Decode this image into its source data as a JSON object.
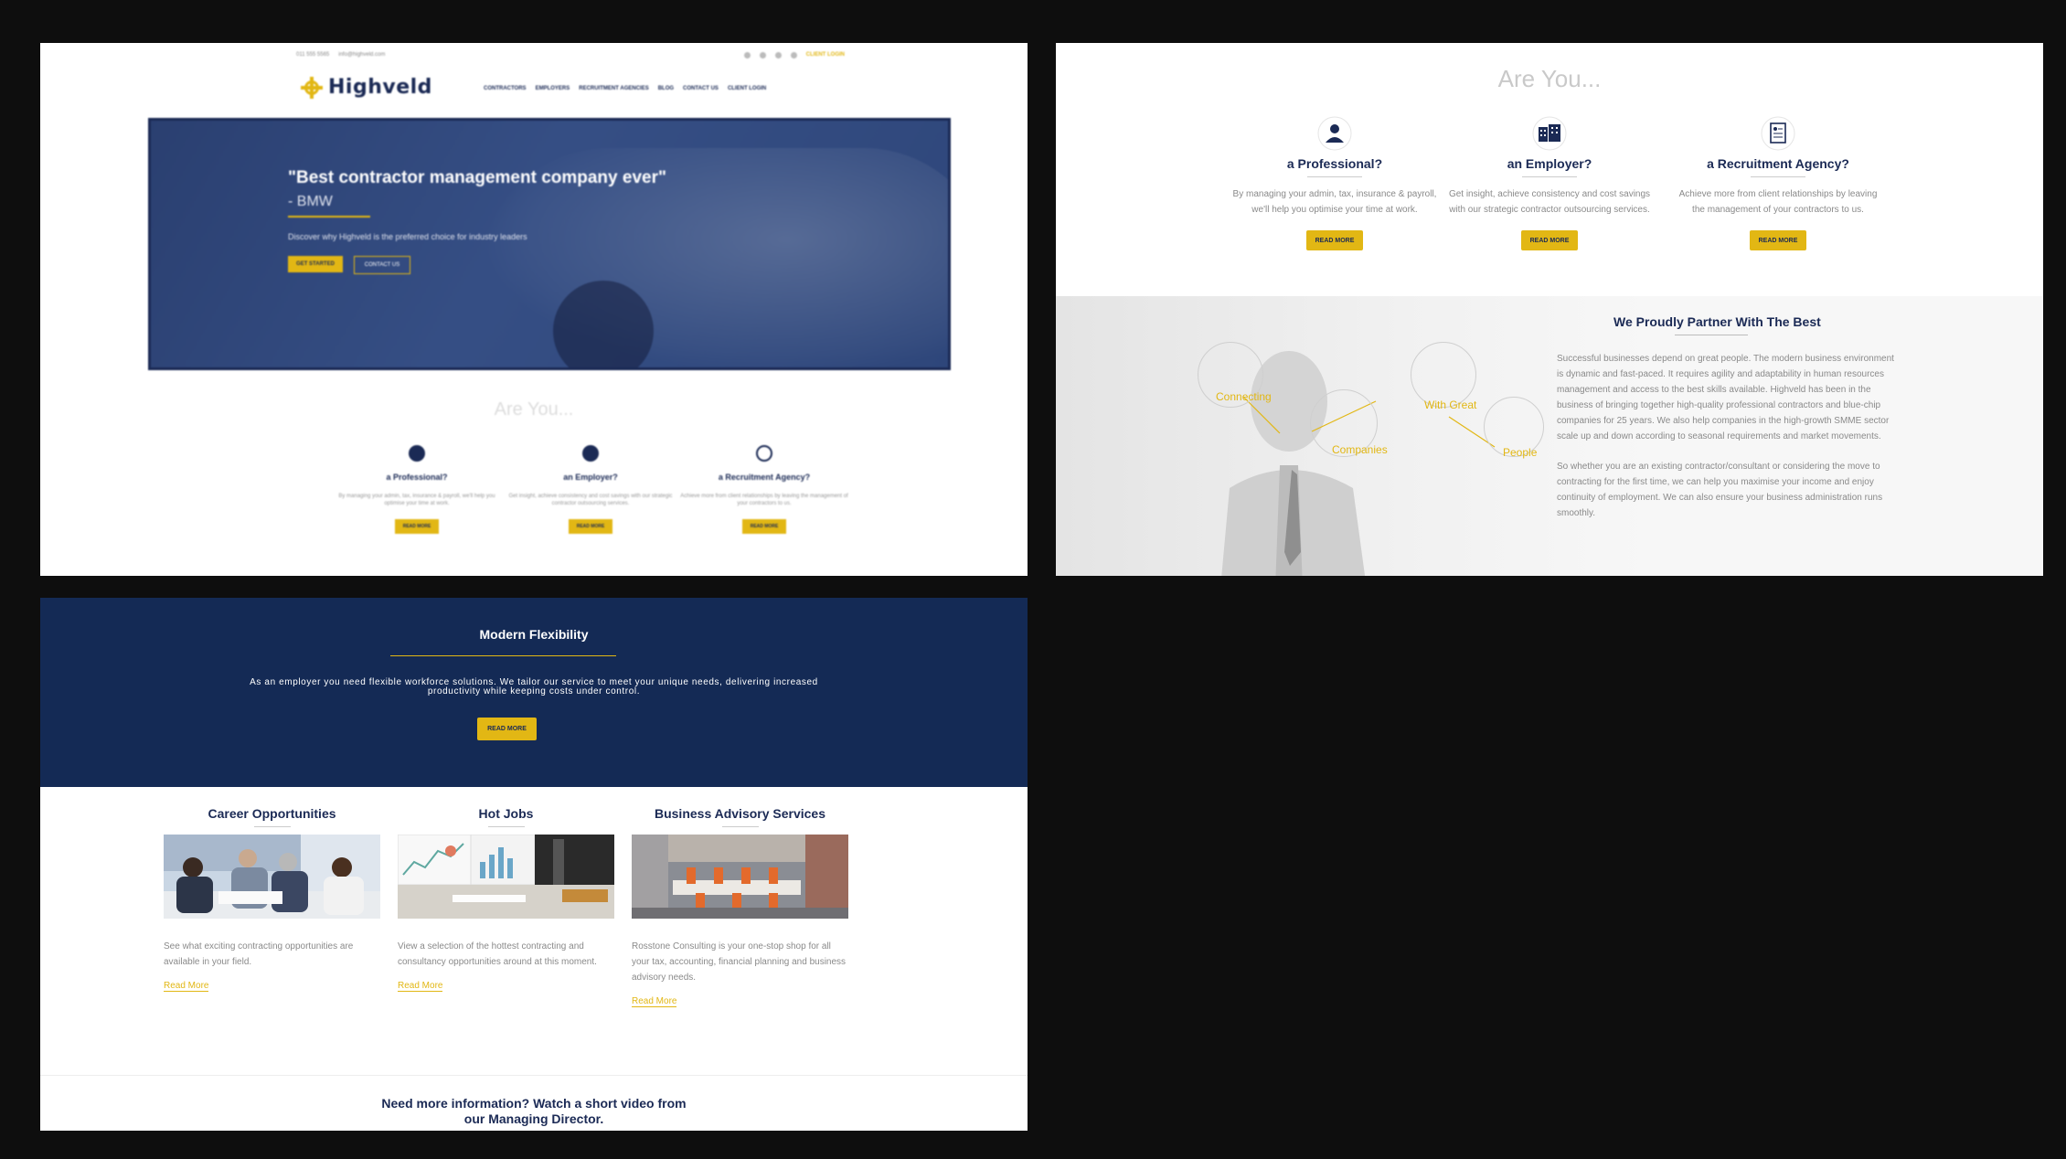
{
  "panel1": {
    "topbar": {
      "phone": "011 555 5565",
      "email": "info@highveld.com",
      "client_login": "CLIENT LOGIN"
    },
    "logo": "Highveld",
    "nav": [
      "CONTRACTORS",
      "EMPLOYERS",
      "RECRUITMENT AGENCIES",
      "BLOG",
      "CONTACT US",
      "CLIENT LOGIN"
    ],
    "hero": {
      "quote": "\"Best contractor management company ever\"",
      "by": "- BMW",
      "sub": "Discover why Highveld is the preferred choice for industry leaders",
      "btn1": "GET STARTED",
      "btn2": "CONTACT US"
    },
    "are_you": "Are You...",
    "cards": [
      {
        "title": "a Professional?",
        "desc": "By managing your admin, tax, insurance & payroll, we'll help you optimise your time at work.",
        "btn": "READ MORE"
      },
      {
        "title": "an Employer?",
        "desc": "Get insight, achieve consistency and cost savings with our strategic contractor outsourcing services.",
        "btn": "READ MORE"
      },
      {
        "title": "a Recruitment Agency?",
        "desc": "Achieve more from client relationships by leaving the management of your contractors to us.",
        "btn": "READ MORE"
      }
    ]
  },
  "panel2": {
    "are_you": "Are You...",
    "cards": [
      {
        "icon": "person-icon",
        "title": "a Professional?",
        "desc1": "By managing your admin, tax, insurance & payroll,",
        "desc2": "we'll help you optimise your time at work.",
        "btn": "READ MORE"
      },
      {
        "icon": "building-icon",
        "title": "an Employer?",
        "desc1": "Get insight, achieve consistency and cost savings",
        "desc2": "with our strategic contractor outsourcing services.",
        "btn": "READ MORE"
      },
      {
        "icon": "document-icon",
        "title": "a Recruitment Agency?",
        "desc1": "Achieve more from client relationships by leaving",
        "desc2": "the management of your contractors to us.",
        "btn": "READ MORE"
      }
    ],
    "partner": {
      "title": "We Proudly Partner With The Best",
      "p1": "Successful businesses depend on great people. The modern business environment is dynamic and fast-paced. It requires agility and adaptability in human resources management and access to the best skills available. Highveld has been in the business of bringing together high-quality professional contractors and blue-chip companies for 25 years. We also help companies in the high-growth SMME sector scale up and down according to seasonal requirements and market movements.",
      "p2": "So whether you are an existing contractor/consultant or considering the move to contracting for the first time, we can help you maximise your income and enjoy continuity of employment. We can also ensure your business administration runs smoothly.",
      "bubbles": [
        "Connecting",
        "Companies",
        "With Great",
        "People"
      ]
    }
  },
  "panel3": {
    "flex": {
      "title": "Modern Flexibility",
      "desc1": "As an employer you need flexible workforce solutions. We tailor our service to meet your unique needs, delivering increased",
      "desc2": "productivity while keeping costs under control.",
      "btn": "READ MORE"
    },
    "services": [
      {
        "title": "Career Opportunities",
        "desc": "See what exciting contracting opportunities are available in your field.",
        "link": "Read More"
      },
      {
        "title": "Hot Jobs",
        "desc": "View a selection of the hottest contracting and consultancy opportunities around at this moment.",
        "link": "Read More"
      },
      {
        "title": "Business Advisory Services",
        "desc": "Rosstone Consulting is your one-stop shop for all your tax, accounting, financial planning and business advisory needs.",
        "link": "Read More"
      }
    ],
    "need_info1": "Need more information? Watch a short video from",
    "need_info2": "our Managing Director."
  },
  "colors": {
    "navy": "#1b2a55",
    "gold": "#e2b714",
    "banner": "#142a55",
    "background": "#0e0e0e"
  }
}
